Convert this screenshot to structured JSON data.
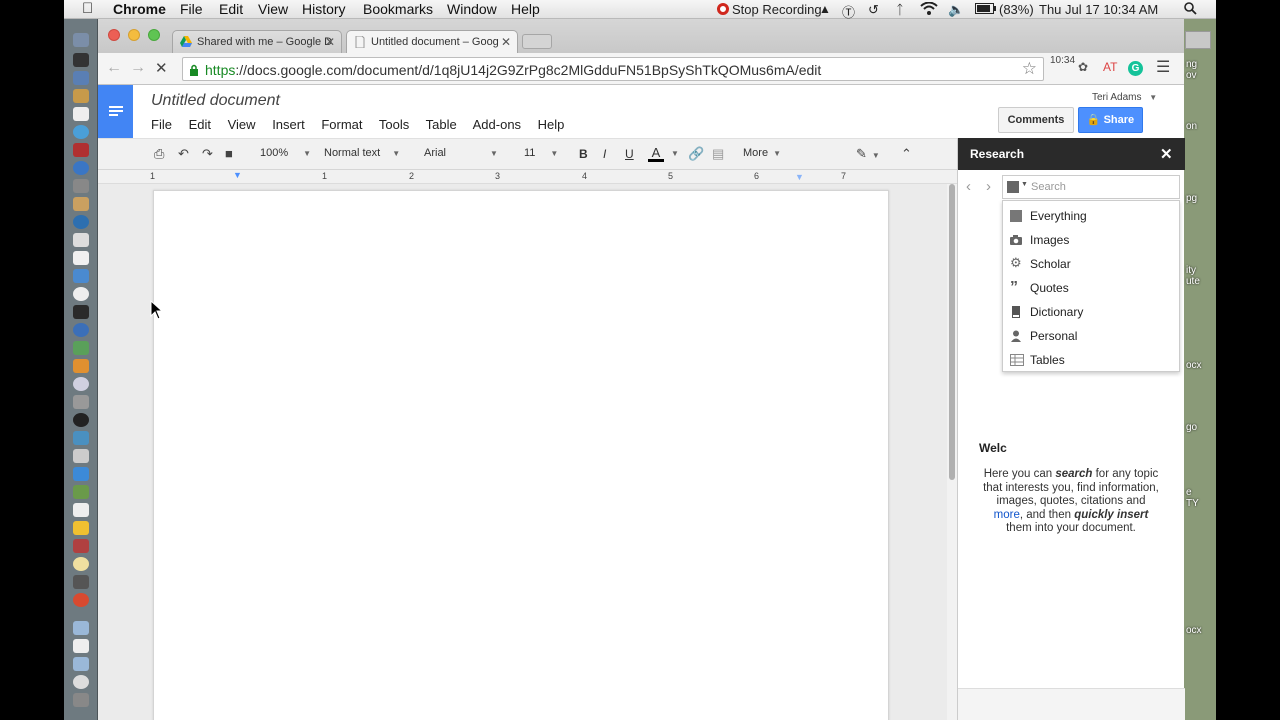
{
  "menubar": {
    "app_name": "Chrome",
    "items": [
      "File",
      "Edit",
      "View",
      "History",
      "Bookmarks",
      "Window",
      "Help"
    ],
    "stop_recording": "Stop Recording",
    "battery": "(83%)",
    "datetime": "Thu Jul 17  10:34 AM"
  },
  "tabs": [
    {
      "title": "Shared with me – Google D"
    },
    {
      "title": "Untitled document – Goog"
    }
  ],
  "address": {
    "https": "https",
    "url_rest": "://docs.google.com/document/d/1q8jU14j2G9ZrPg8c2MlGdduFN51BpSyShTkQOMus6mA/edit"
  },
  "extensions": {
    "clock": "10:34",
    "at": "AT"
  },
  "docs": {
    "title": "Untitled document",
    "menu": [
      "File",
      "Edit",
      "View",
      "Insert",
      "Format",
      "Tools",
      "Table",
      "Add-ons",
      "Help"
    ],
    "user": "Teri Adams",
    "comments_label": "Comments",
    "share_label": "Share"
  },
  "toolbar": {
    "zoom": "100%",
    "style": "Normal text",
    "font": "Arial",
    "size": "11",
    "bold": "B",
    "italic": "I",
    "underline": "U",
    "text_color": "A",
    "more": "More"
  },
  "ruler": {
    "numbers": [
      "1",
      "1",
      "2",
      "3",
      "4",
      "5",
      "6",
      "7"
    ]
  },
  "research": {
    "title": "Research",
    "search_placeholder": "Search",
    "options": [
      "Everything",
      "Images",
      "Scholar",
      "Quotes",
      "Dictionary",
      "Personal",
      "Tables"
    ],
    "welcome_title": "Welc",
    "welcome_lines": {
      "l1a": "Here you can ",
      "l1b": "search",
      "l1c": " for any topic",
      "l2": "that interests you, find information,",
      "l3": "images, quotes, citations and",
      "l4a": "more",
      "l4b": ", and then ",
      "l4c": "quickly insert",
      "l5": "them into your document."
    }
  },
  "desktop_labels": [
    "ng",
    "ov",
    "on",
    "pg",
    "ity",
    "ute",
    "ocx",
    "go",
    "e",
    "TY",
    "ocx"
  ],
  "colors": {
    "docs_blue": "#4285f4",
    "share_blue": "#4d90fe",
    "research_header": "#2a2a2a",
    "record_red": "#d0271d"
  }
}
